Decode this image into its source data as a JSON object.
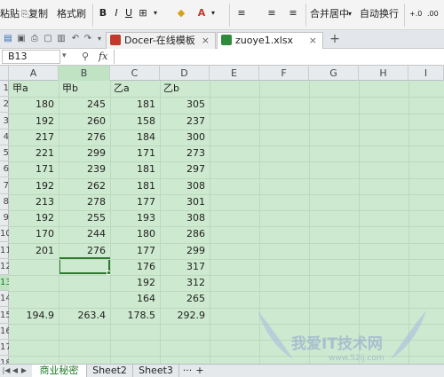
{
  "ribbon": {
    "paste_label": "粘贴",
    "copy_label": "复制",
    "format_painter_label": "格式刷",
    "merge_center_label": "合并居中",
    "wrap_text_label": "自动换行",
    "bold": "B",
    "italic": "I",
    "underline": "U",
    "increase_decimal": "+.0",
    "decrease_decimal": ".00",
    "font_color_letter": "A"
  },
  "tabs": [
    {
      "label": "Docer-在线模板",
      "icon": "docer-icon",
      "color": "#c0392b",
      "active": false
    },
    {
      "label": "zuoye1.xlsx",
      "icon": "spreadsheet-icon",
      "color": "#2e8b3a",
      "active": true
    }
  ],
  "formula_bar": {
    "name_box": "B13",
    "fx": "fx",
    "value": ""
  },
  "columns": [
    "A",
    "B",
    "C",
    "D",
    "E",
    "F",
    "G",
    "H",
    "I"
  ],
  "selected_column": "B",
  "rows": [
    "1",
    "2",
    "3",
    "4",
    "5",
    "6",
    "7",
    "8",
    "9",
    "10",
    "11",
    "12",
    "13",
    "14",
    "15",
    "16",
    "17",
    "18"
  ],
  "selected_row": "13",
  "headers": [
    "甲a",
    "甲b",
    "乙a",
    "乙b"
  ],
  "data": [
    [
      "180",
      "245",
      "181",
      "305"
    ],
    [
      "192",
      "260",
      "158",
      "237"
    ],
    [
      "217",
      "276",
      "184",
      "300"
    ],
    [
      "221",
      "299",
      "171",
      "273"
    ],
    [
      "171",
      "239",
      "181",
      "297"
    ],
    [
      "192",
      "262",
      "181",
      "308"
    ],
    [
      "213",
      "278",
      "177",
      "301"
    ],
    [
      "192",
      "255",
      "193",
      "308"
    ],
    [
      "170",
      "244",
      "180",
      "286"
    ],
    [
      "201",
      "276",
      "177",
      "299"
    ],
    [
      "",
      "",
      "176",
      "317"
    ],
    [
      "",
      "",
      "192",
      "312"
    ],
    [
      "",
      "",
      "164",
      "265"
    ]
  ],
  "averages": [
    "194.9",
    "263.4",
    "178.5",
    "292.9"
  ],
  "sheets": [
    "商业秘密",
    "Sheet2",
    "Sheet3"
  ],
  "sheet_more": "···",
  "sheet_add": "+",
  "watermark": {
    "text": "我爱IT技术网",
    "url": "www.52ij.com"
  },
  "colors": {
    "grid_bg": "#cde9cf",
    "selection": "#2f7a2f",
    "header_bg": "#e8ebee"
  }
}
